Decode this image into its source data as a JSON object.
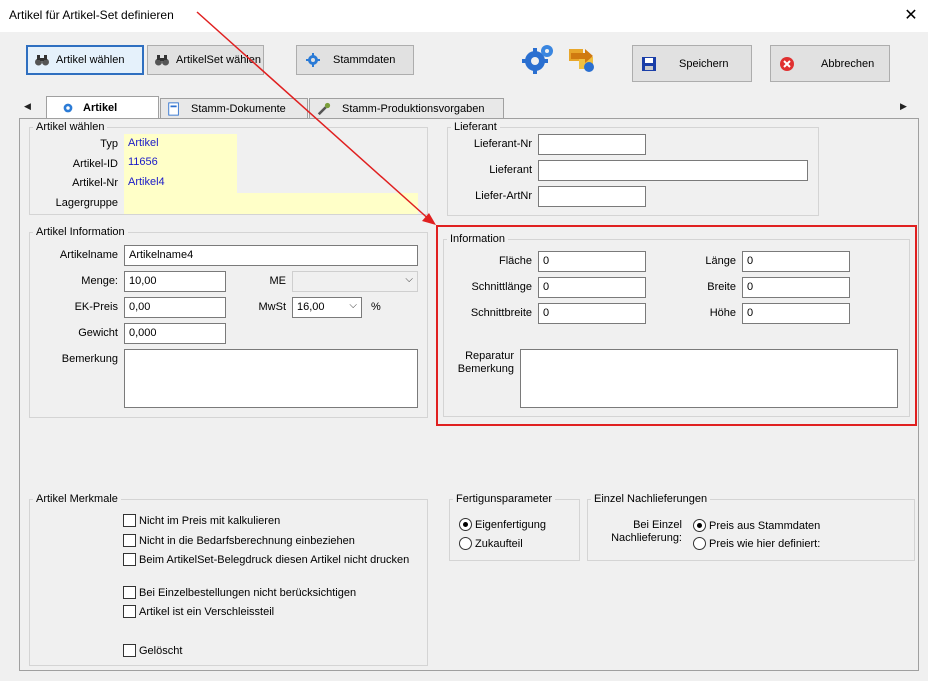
{
  "window": {
    "title": "Artikel für Artikel-Set  definieren",
    "close_glyph": "✕"
  },
  "toolbar": {
    "artikel_waehlen": "Artikel wählen",
    "artikelset_waehlen": "ArtikelSet wählen",
    "stammdaten": "Stammdaten",
    "speichern": "Speichern",
    "abbrechen": "Abbrechen"
  },
  "tabs": [
    "Artikel",
    "Stamm-Dokumente",
    "Stamm-Produktionsvorgaben"
  ],
  "artikel_waehlen": {
    "title": "Artikel wählen",
    "typ_label": "Typ",
    "typ_value": "Artikel",
    "id_label": "Artikel-ID",
    "id_value": "11656",
    "nr_label": "Artikel-Nr",
    "nr_value": "Artikel4",
    "lagergruppe_label": "Lagergruppe",
    "lagergruppe_value": ""
  },
  "artikel_info": {
    "title": "Artikel Information",
    "name_label": "Artikelname",
    "name_value": "Artikelname4",
    "menge_label": "Menge:",
    "menge_value": "10,00",
    "me_label": "ME",
    "me_value": "",
    "ekpreis_label": "EK-Preis",
    "ekpreis_value": "0,00",
    "mwst_label": "MwSt",
    "mwst_value": "16,00",
    "percent": "%",
    "gewicht_label": "Gewicht",
    "gewicht_value": "0,000",
    "bemerkung_label": "Bemerkung",
    "bemerkung_value": ""
  },
  "lieferant": {
    "title": "Lieferant",
    "nr_label": "Lieferant-Nr",
    "nr_value": "",
    "name_label": "Lieferant",
    "name_value": "",
    "artnr_label": "Liefer-ArtNr",
    "artnr_value": ""
  },
  "information": {
    "title": "Information",
    "flaeche_label": "Fläche",
    "flaeche_value": "0",
    "schnittlaenge_label": "Schnittlänge",
    "schnittlaenge_value": "0",
    "schnittbreite_label": "Schnittbreite",
    "schnittbreite_value": "0",
    "laenge_label": "Länge",
    "laenge_value": "0",
    "breite_label": "Breite",
    "breite_value": "0",
    "hoehe_label": "Höhe",
    "hoehe_value": "0",
    "reparatur_label_1": "Reparatur",
    "reparatur_label_2": "Bemerkung",
    "reparatur_value": ""
  },
  "merkmale": {
    "title": "Artikel Merkmale",
    "items": [
      "Nicht im Preis mit kalkulieren",
      "Nicht in die Bedarfsberechnung einbeziehen",
      "Beim ArtikelSet-Belegdruck diesen Artikel nicht drucken",
      "Bei Einzelbestellungen nicht berücksichtigen",
      "Artikel ist ein Verschleissteil",
      "Gelöscht"
    ]
  },
  "fertigung": {
    "title": "Fertigunsparameter",
    "option_1": "Eigenfertigung",
    "option_2": "Zukaufteil"
  },
  "nachlieferung": {
    "title": "Einzel Nachlieferungen",
    "label_1": "Bei Einzel",
    "label_2": "Nachlieferung:",
    "option_1": "Preis aus Stammdaten",
    "option_2": "Preis wie hier definiert:"
  },
  "colors": {
    "annotation_red": "#e02020",
    "readonly_yellow": "#ffffc8",
    "link_blue": "#1a1ac8"
  }
}
